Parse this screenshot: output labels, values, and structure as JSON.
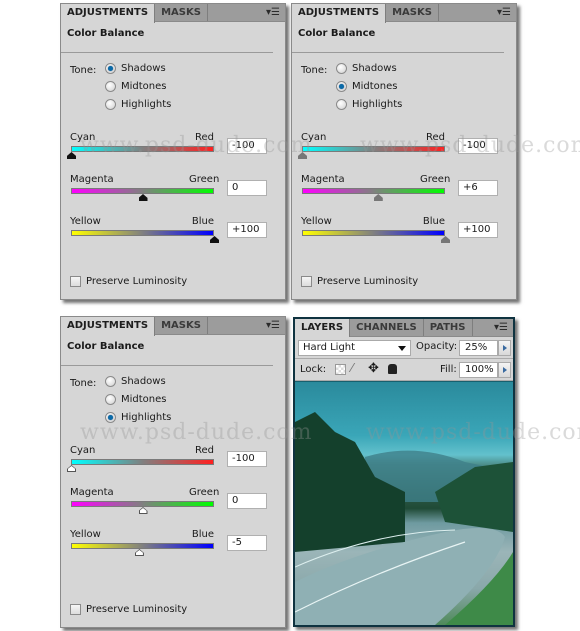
{
  "panels": [
    {
      "tabs": [
        "ADJUSTMENTS",
        "MASKS"
      ],
      "title": "Color Balance",
      "tone_label": "Tone:",
      "tones": [
        "Shadows",
        "Midtones",
        "Highlights"
      ],
      "selected_tone": "Shadows",
      "sliders": [
        {
          "left": "Cyan",
          "right": "Red",
          "value": "-100",
          "numeric": -100
        },
        {
          "left": "Magenta",
          "right": "Green",
          "value": "0",
          "numeric": 0
        },
        {
          "left": "Yellow",
          "right": "Blue",
          "value": "+100",
          "numeric": 100
        }
      ],
      "thumb_style": "black",
      "preserve_luminosity": {
        "label": "Preserve Luminosity",
        "checked": false
      }
    },
    {
      "tabs": [
        "ADJUSTMENTS",
        "MASKS"
      ],
      "title": "Color Balance",
      "tone_label": "Tone:",
      "tones": [
        "Shadows",
        "Midtones",
        "Highlights"
      ],
      "selected_tone": "Midtones",
      "sliders": [
        {
          "left": "Cyan",
          "right": "Red",
          "value": "-100",
          "numeric": -100
        },
        {
          "left": "Magenta",
          "right": "Green",
          "value": "+6",
          "numeric": 6
        },
        {
          "left": "Yellow",
          "right": "Blue",
          "value": "+100",
          "numeric": 100
        }
      ],
      "thumb_style": "gray",
      "preserve_luminosity": {
        "label": "Preserve Luminosity",
        "checked": false
      }
    },
    {
      "tabs": [
        "ADJUSTMENTS",
        "MASKS"
      ],
      "title": "Color Balance",
      "tone_label": "Tone:",
      "tones": [
        "Shadows",
        "Midtones",
        "Highlights"
      ],
      "selected_tone": "Highlights",
      "sliders": [
        {
          "left": "Cyan",
          "right": "Red",
          "value": "-100",
          "numeric": -100
        },
        {
          "left": "Magenta",
          "right": "Green",
          "value": "0",
          "numeric": 0
        },
        {
          "left": "Yellow",
          "right": "Blue",
          "value": "-5",
          "numeric": -5
        }
      ],
      "thumb_style": "white",
      "preserve_luminosity": {
        "label": "Preserve Luminosity",
        "checked": false
      }
    }
  ],
  "slider_gradients": [
    [
      "#00ffff",
      "#ff2020"
    ],
    [
      "#ff00ff",
      "#00ff00"
    ],
    [
      "#ffff00",
      "#0000ff"
    ]
  ],
  "layers": {
    "tabs": [
      "LAYERS",
      "CHANNELS",
      "PATHS"
    ],
    "blend_mode": "Hard Light",
    "opacity_label": "Opacity:",
    "opacity": "25%",
    "lock_label": "Lock:",
    "fill_label": "Fill:",
    "fill": "100%"
  },
  "watermark": "www.psd-dude.com"
}
